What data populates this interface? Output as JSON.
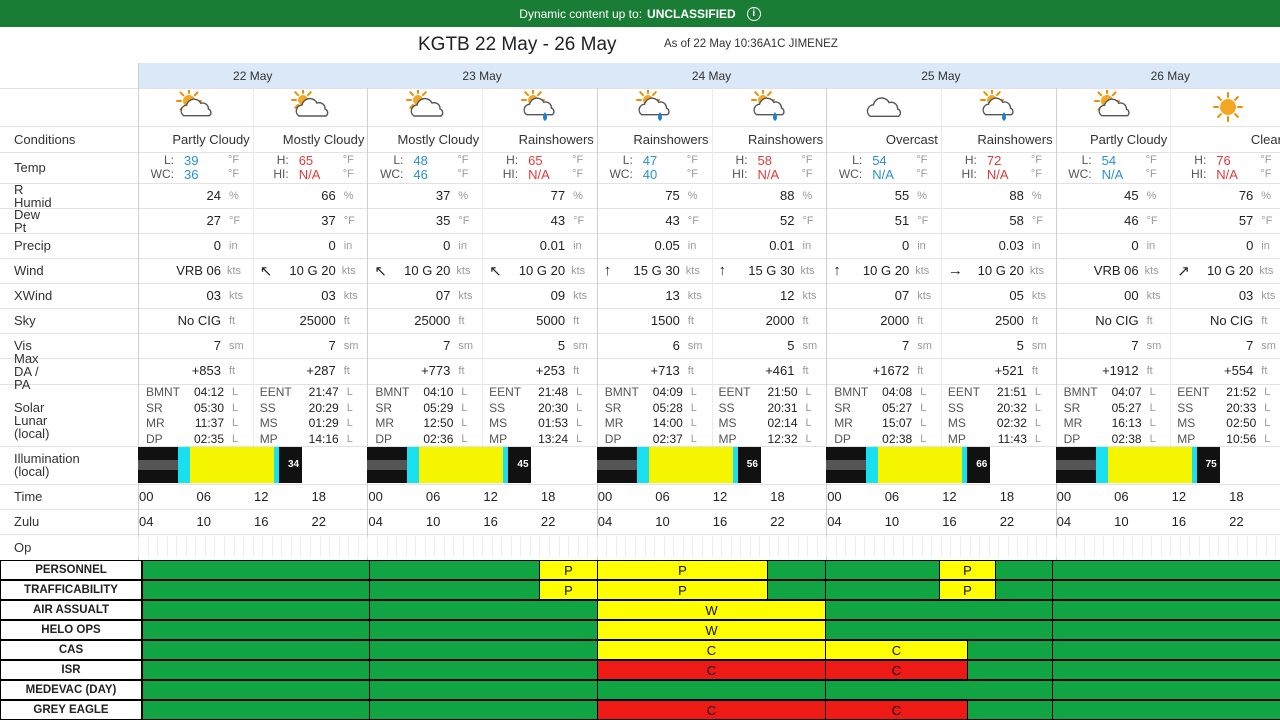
{
  "banner": {
    "prefix": "Dynamic content up to:",
    "classification": "UNCLASSIFIED",
    "info_icon": "info-icon"
  },
  "title": {
    "main": "KGTB 22 May - 26 May",
    "sub": "As of 22 May 10:36A1C JIMENEZ"
  },
  "days": [
    "22 May",
    "23 May",
    "24 May",
    "25 May",
    "26 May"
  ],
  "row_labels": {
    "conditions": "Conditions",
    "temp": "Temp",
    "humid": "R Humid",
    "dew": "Dew Pt",
    "precip": "Precip",
    "wind": "Wind",
    "xwind": "XWind",
    "sky": "Sky",
    "vis": "Vis",
    "da": "Max DA / PA",
    "solar1": "Solar Lunar",
    "solar2": "(local)",
    "illum1": "Illumination",
    "illum2": "(local)",
    "time": "Time",
    "zulu": "Zulu",
    "op": "Op"
  },
  "units": {
    "temp": "°F",
    "pct": "%",
    "in": "in",
    "kts": "kts",
    "ft": "ft",
    "sm": "sm",
    "L": "L"
  },
  "periods": [
    {
      "cond": "Partly Cloudy",
      "icon": "partly-cloudy-icon",
      "t1l": "L:",
      "t1": "39",
      "t1c": "blue",
      "t2l": "WC:",
      "t2": "36",
      "t2c": "blue",
      "humid": "24",
      "dew": "27",
      "precip": "0",
      "wind": "VRB 06",
      "wdir": "",
      "xwind": "03",
      "sky": "No CIG",
      "vis": "7",
      "da": "+853"
    },
    {
      "cond": "Mostly Cloudy",
      "icon": "mostly-cloudy-icon",
      "t1l": "H:",
      "t1": "65",
      "t1c": "red",
      "t2l": "HI:",
      "t2": "N/A",
      "t2c": "red",
      "humid": "66",
      "dew": "37",
      "precip": "0",
      "wind": "10 G 20",
      "wdir": "↖",
      "xwind": "03",
      "sky": "25000",
      "vis": "7",
      "da": "+287"
    },
    {
      "cond": "Mostly Cloudy",
      "icon": "mostly-cloudy-icon",
      "t1l": "L:",
      "t1": "48",
      "t1c": "blue",
      "t2l": "WC:",
      "t2": "46",
      "t2c": "blue",
      "humid": "37",
      "dew": "35",
      "precip": "0",
      "wind": "10 G 20",
      "wdir": "↖",
      "xwind": "07",
      "sky": "25000",
      "vis": "7",
      "da": "+773"
    },
    {
      "cond": "Rainshowers",
      "icon": "rainshowers-icon",
      "t1l": "H:",
      "t1": "65",
      "t1c": "red",
      "t2l": "HI:",
      "t2": "N/A",
      "t2c": "red",
      "humid": "77",
      "dew": "43",
      "precip": "0.01",
      "wind": "10 G 20",
      "wdir": "↖",
      "xwind": "09",
      "sky": "5000",
      "vis": "5",
      "da": "+253"
    },
    {
      "cond": "Rainshowers",
      "icon": "rainshowers-icon",
      "t1l": "L:",
      "t1": "47",
      "t1c": "blue",
      "t2l": "WC:",
      "t2": "40",
      "t2c": "blue",
      "humid": "75",
      "dew": "43",
      "precip": "0.05",
      "wind": "15 G 30",
      "wdir": "↑",
      "xwind": "13",
      "sky": "1500",
      "vis": "6",
      "da": "+713"
    },
    {
      "cond": "Rainshowers",
      "icon": "rainshowers-icon",
      "t1l": "H:",
      "t1": "58",
      "t1c": "red",
      "t2l": "HI:",
      "t2": "N/A",
      "t2c": "red",
      "humid": "88",
      "dew": "52",
      "precip": "0.01",
      "wind": "15 G 30",
      "wdir": "↑",
      "xwind": "12",
      "sky": "2000",
      "vis": "5",
      "da": "+461"
    },
    {
      "cond": "Overcast",
      "icon": "overcast-icon",
      "t1l": "L:",
      "t1": "54",
      "t1c": "blue",
      "t2l": "WC:",
      "t2": "N/A",
      "t2c": "blue",
      "humid": "55",
      "dew": "51",
      "precip": "0",
      "wind": "10 G 20",
      "wdir": "↑",
      "xwind": "07",
      "sky": "2000",
      "vis": "7",
      "da": "+1672"
    },
    {
      "cond": "Rainshowers",
      "icon": "rainshowers-icon",
      "t1l": "H:",
      "t1": "72",
      "t1c": "red",
      "t2l": "HI:",
      "t2": "N/A",
      "t2c": "red",
      "humid": "88",
      "dew": "58",
      "precip": "0.03",
      "wind": "10 G 20",
      "wdir": "→",
      "xwind": "05",
      "sky": "2500",
      "vis": "5",
      "da": "+521"
    },
    {
      "cond": "Partly Cloudy",
      "icon": "partly-cloudy-icon",
      "t1l": "L:",
      "t1": "54",
      "t1c": "blue",
      "t2l": "WC:",
      "t2": "N/A",
      "t2c": "blue",
      "humid": "45",
      "dew": "46",
      "precip": "0",
      "wind": "VRB 06",
      "wdir": "",
      "xwind": "00",
      "sky": "No CIG",
      "vis": "7",
      "da": "+1912"
    },
    {
      "cond": "Clear",
      "icon": "sun-icon",
      "t1l": "H:",
      "t1": "76",
      "t1c": "red",
      "t2l": "HI:",
      "t2": "N/A",
      "t2c": "red",
      "humid": "76",
      "dew": "57",
      "precip": "0",
      "wind": "10 G 20",
      "wdir": "↗",
      "xwind": "03",
      "sky": "No CIG",
      "vis": "7",
      "da": "+554"
    }
  ],
  "solar_labels_left": [
    "BMNT",
    "SR",
    "MR",
    "DP"
  ],
  "solar_labels_right": [
    "EENT",
    "SS",
    "MS",
    "MP"
  ],
  "solar": [
    {
      "left": [
        "04:12",
        "05:30",
        "11:37",
        "02:35"
      ],
      "right": [
        "21:47",
        "20:29",
        "01:29",
        "14:16"
      ]
    },
    {
      "left": [
        "04:10",
        "05:29",
        "12:50",
        "02:36"
      ],
      "right": [
        "21:48",
        "20:30",
        "01:53",
        "13:24"
      ]
    },
    {
      "left": [
        "04:09",
        "05:28",
        "14:00",
        "02:37"
      ],
      "right": [
        "21:50",
        "20:31",
        "02:14",
        "12:32"
      ]
    },
    {
      "left": [
        "04:08",
        "05:27",
        "15:07",
        "02:38"
      ],
      "right": [
        "21:51",
        "20:32",
        "02:32",
        "11:43"
      ]
    },
    {
      "left": [
        "04:07",
        "05:27",
        "16:13",
        "02:38"
      ],
      "right": [
        "21:52",
        "20:33",
        "02:50",
        "10:56"
      ]
    }
  ],
  "illumination_pct": [
    "34",
    "45",
    "56",
    "66",
    "75"
  ],
  "time_ticks": [
    "00",
    "06",
    "12",
    "18"
  ],
  "zulu_ticks": [
    "04",
    "10",
    "16",
    "22"
  ],
  "colors": {
    "go": "#10a443",
    "caution": "#ffff00",
    "nogo": "#ee1a15",
    "day_header": "#dbe8f8",
    "banner": "#1a7d35"
  },
  "operations": [
    {
      "name": "PERSONNEL",
      "segments": [
        {
          "c": "g",
          "s": 0,
          "e": 227,
          "t": ""
        },
        {
          "c": "g",
          "s": 227,
          "e": 397,
          "t": ""
        },
        {
          "c": "y",
          "s": 397,
          "e": 455,
          "t": "P"
        },
        {
          "c": "y",
          "s": 455,
          "e": 625,
          "t": "P"
        },
        {
          "c": "g",
          "s": 625,
          "e": 683,
          "t": ""
        },
        {
          "c": "g",
          "s": 683,
          "e": 797,
          "t": ""
        },
        {
          "c": "y",
          "s": 797,
          "e": 853,
          "t": "P"
        },
        {
          "c": "g",
          "s": 853,
          "e": 910,
          "t": ""
        },
        {
          "c": "g",
          "s": 910,
          "e": 1138,
          "t": ""
        }
      ]
    },
    {
      "name": "TRAFFICABILITY",
      "segments": [
        {
          "c": "g",
          "s": 0,
          "e": 227,
          "t": ""
        },
        {
          "c": "g",
          "s": 227,
          "e": 397,
          "t": ""
        },
        {
          "c": "y",
          "s": 397,
          "e": 455,
          "t": "P"
        },
        {
          "c": "y",
          "s": 455,
          "e": 625,
          "t": "P"
        },
        {
          "c": "g",
          "s": 625,
          "e": 683,
          "t": ""
        },
        {
          "c": "g",
          "s": 683,
          "e": 797,
          "t": ""
        },
        {
          "c": "y",
          "s": 797,
          "e": 853,
          "t": "P"
        },
        {
          "c": "g",
          "s": 853,
          "e": 910,
          "t": ""
        },
        {
          "c": "g",
          "s": 910,
          "e": 1138,
          "t": ""
        }
      ]
    },
    {
      "name": "AIR ASSUALT",
      "segments": [
        {
          "c": "g",
          "s": 0,
          "e": 227,
          "t": ""
        },
        {
          "c": "g",
          "s": 227,
          "e": 455,
          "t": ""
        },
        {
          "c": "y",
          "s": 455,
          "e": 683,
          "t": "W"
        },
        {
          "c": "g",
          "s": 683,
          "e": 910,
          "t": ""
        },
        {
          "c": "g",
          "s": 910,
          "e": 1138,
          "t": ""
        }
      ]
    },
    {
      "name": "HELO OPS",
      "segments": [
        {
          "c": "g",
          "s": 0,
          "e": 227,
          "t": ""
        },
        {
          "c": "g",
          "s": 227,
          "e": 455,
          "t": ""
        },
        {
          "c": "y",
          "s": 455,
          "e": 683,
          "t": "W"
        },
        {
          "c": "g",
          "s": 683,
          "e": 910,
          "t": ""
        },
        {
          "c": "g",
          "s": 910,
          "e": 1138,
          "t": ""
        }
      ]
    },
    {
      "name": "CAS",
      "segments": [
        {
          "c": "g",
          "s": 0,
          "e": 227,
          "t": ""
        },
        {
          "c": "g",
          "s": 227,
          "e": 455,
          "t": ""
        },
        {
          "c": "y",
          "s": 455,
          "e": 683,
          "t": "C"
        },
        {
          "c": "y",
          "s": 683,
          "e": 825,
          "t": "C"
        },
        {
          "c": "g",
          "s": 825,
          "e": 910,
          "t": ""
        },
        {
          "c": "g",
          "s": 910,
          "e": 1138,
          "t": ""
        }
      ]
    },
    {
      "name": "ISR",
      "segments": [
        {
          "c": "g",
          "s": 0,
          "e": 227,
          "t": ""
        },
        {
          "c": "g",
          "s": 227,
          "e": 455,
          "t": ""
        },
        {
          "c": "r",
          "s": 455,
          "e": 683,
          "t": "C"
        },
        {
          "c": "r",
          "s": 683,
          "e": 825,
          "t": "C"
        },
        {
          "c": "g",
          "s": 825,
          "e": 910,
          "t": ""
        },
        {
          "c": "g",
          "s": 910,
          "e": 1138,
          "t": ""
        }
      ]
    },
    {
      "name": "MEDEVAC (DAY)",
      "segments": [
        {
          "c": "g",
          "s": 0,
          "e": 227,
          "t": ""
        },
        {
          "c": "g",
          "s": 227,
          "e": 455,
          "t": ""
        },
        {
          "c": "g",
          "s": 455,
          "e": 683,
          "t": ""
        },
        {
          "c": "g",
          "s": 683,
          "e": 910,
          "t": ""
        },
        {
          "c": "g",
          "s": 910,
          "e": 1138,
          "t": ""
        }
      ]
    },
    {
      "name": "GREY EAGLE",
      "segments": [
        {
          "c": "g",
          "s": 0,
          "e": 227,
          "t": ""
        },
        {
          "c": "g",
          "s": 227,
          "e": 455,
          "t": ""
        },
        {
          "c": "r",
          "s": 455,
          "e": 683,
          "t": "C"
        },
        {
          "c": "r",
          "s": 683,
          "e": 825,
          "t": "C"
        },
        {
          "c": "g",
          "s": 825,
          "e": 910,
          "t": ""
        },
        {
          "c": "g",
          "s": 910,
          "e": 1138,
          "t": ""
        }
      ]
    }
  ]
}
